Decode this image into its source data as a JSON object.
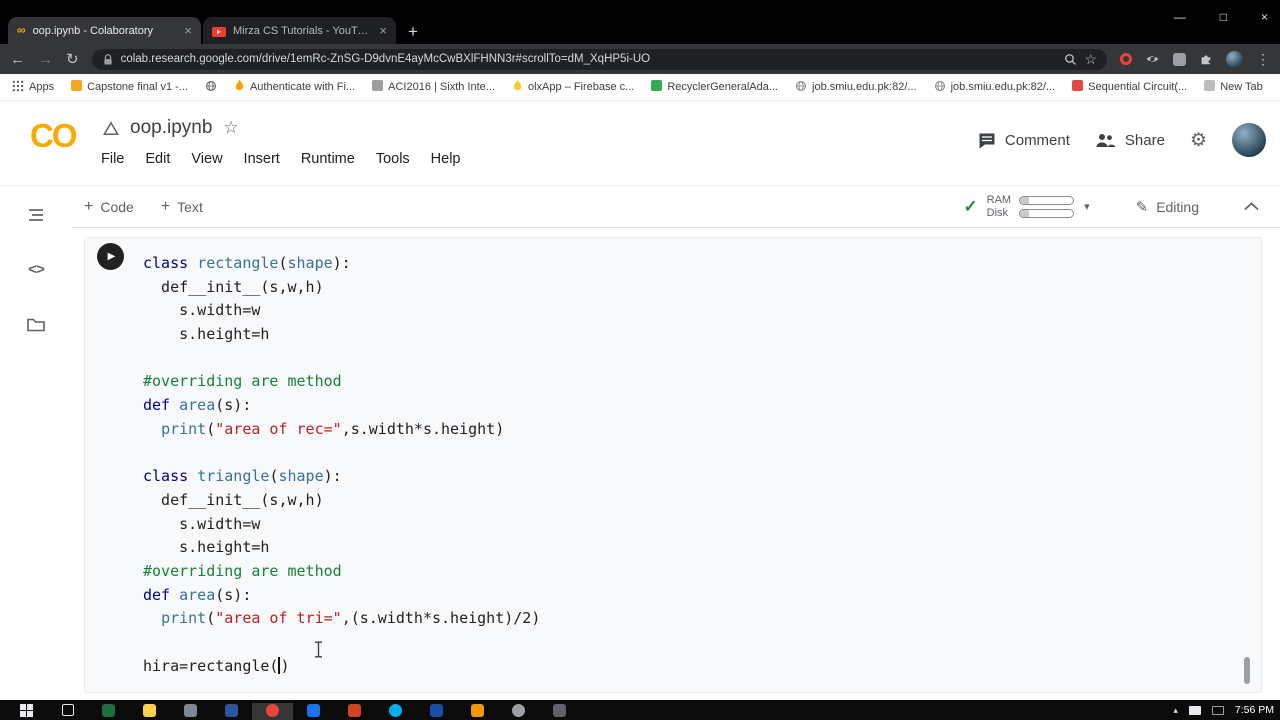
{
  "window": {
    "minimize": "—",
    "maximize": "□",
    "close": "×"
  },
  "browser": {
    "tabs": [
      {
        "label": "oop.ipynb - Colaboratory",
        "favicon": "colab",
        "active": true
      },
      {
        "label": "Mirza CS Tutorials - YouTube",
        "favicon": "youtube",
        "active": false
      }
    ],
    "new_tab_label": "+",
    "nav": {
      "back": "←",
      "forward": "→",
      "refresh": "↻"
    },
    "url": "colab.research.google.com/drive/1emRc-ZnSG-D9dvnE4ayMcCwBXlFHNN3r#scrollTo=dM_XqHP5i-UO",
    "extension_icons": [
      "zoom-icon",
      "bookmark-star-icon",
      "adblock-extension-icon",
      "eye-extension-icon",
      "extension-icon",
      "extensions-puzzle-icon",
      "profile-avatar",
      "browser-menu-icon"
    ],
    "bookmarks": [
      {
        "label": "Apps",
        "icon": "grid",
        "color": "#5f6368"
      },
      {
        "label": "Capstone final v1 -...",
        "icon": "square",
        "color": "#f5a623"
      },
      {
        "label": "",
        "icon": "globe",
        "color": "#5f6368"
      },
      {
        "label": "Authenticate with Fi...",
        "icon": "flame",
        "color": "#ffa000"
      },
      {
        "label": "ACI2016 | Sixth Inte...",
        "icon": "square",
        "color": "#9e9e9e"
      },
      {
        "label": "olxApp – Firebase c...",
        "icon": "flame",
        "color": "#ffca28"
      },
      {
        "label": "RecyclerGeneralAda...",
        "icon": "square",
        "color": "#34a853"
      },
      {
        "label": "job.smiu.edu.pk:82/...",
        "icon": "globe",
        "color": "#80868b"
      },
      {
        "label": "job.smiu.edu.pk:82/...",
        "icon": "globe",
        "color": "#80868b"
      },
      {
        "label": "Sequential Circuit(...",
        "icon": "square",
        "color": "#e04a3f"
      },
      {
        "label": "New Tab",
        "icon": "square",
        "color": "#bdbdbd"
      }
    ]
  },
  "colab": {
    "logo": "CO",
    "title": "oop.ipynb",
    "menus": [
      "File",
      "Edit",
      "View",
      "Insert",
      "Runtime",
      "Tools",
      "Help"
    ],
    "comment": "Comment",
    "share": "Share",
    "toolbar": {
      "add_code": "Code",
      "add_text": "Text",
      "ram": "RAM",
      "disk": "Disk",
      "editing": "Editing"
    }
  },
  "code": {
    "lines": [
      [
        [
          "class ",
          "kw"
        ],
        [
          "rectangle",
          "nm"
        ],
        [
          "(",
          "pl"
        ],
        [
          "shape",
          "nm"
        ],
        [
          "):",
          "pl"
        ]
      ],
      [
        [
          "  def__init__(s,w,h)",
          "pl"
        ]
      ],
      [
        [
          "    s.width=w",
          "pl"
        ]
      ],
      [
        [
          "    s.height=h",
          "pl"
        ]
      ],
      [],
      [
        [
          "#overriding are method",
          "cm"
        ]
      ],
      [
        [
          "def ",
          "kw"
        ],
        [
          "area",
          "nm"
        ],
        [
          "(s):",
          "pl"
        ]
      ],
      [
        [
          "  ",
          "pl"
        ],
        [
          "print",
          "nm"
        ],
        [
          "(",
          "pl"
        ],
        [
          "\"area of rec=\"",
          "st"
        ],
        [
          ",s.width*s.height)",
          "pl"
        ]
      ],
      [],
      [
        [
          "class ",
          "kw"
        ],
        [
          "triangle",
          "nm"
        ],
        [
          "(",
          "pl"
        ],
        [
          "shape",
          "nm"
        ],
        [
          "):",
          "pl"
        ]
      ],
      [
        [
          "  def__init__(s,w,h)",
          "pl"
        ]
      ],
      [
        [
          "    s.width=w",
          "pl"
        ]
      ],
      [
        [
          "    s.height=h",
          "pl"
        ]
      ],
      [
        [
          "#overriding are method",
          "cm"
        ]
      ],
      [
        [
          "def ",
          "kw"
        ],
        [
          "area",
          "nm"
        ],
        [
          "(s):",
          "pl"
        ]
      ],
      [
        [
          "  ",
          "pl"
        ],
        [
          "print",
          "nm"
        ],
        [
          "(",
          "pl"
        ],
        [
          "\"area of tri=\"",
          "st"
        ],
        [
          ",(s.width*s.height)/2)",
          "pl"
        ]
      ],
      [],
      [
        [
          "hira=rectangle(",
          "pl"
        ],
        [
          "",
          "caret"
        ],
        [
          ")",
          "pl"
        ]
      ]
    ]
  },
  "taskbar": {
    "clock": "7:56 PM",
    "icons": [
      {
        "name": "start-button",
        "shape": "win"
      },
      {
        "name": "task-view-button",
        "shape": "outline"
      },
      {
        "name": "taskbar-app-excel",
        "shape": "square",
        "color": "#1d6f42"
      },
      {
        "name": "taskbar-app-file-explorer",
        "shape": "square",
        "color": "#ffd04c"
      },
      {
        "name": "taskbar-app-3",
        "shape": "square",
        "color": "#7b8794"
      },
      {
        "name": "taskbar-app-word",
        "shape": "square",
        "color": "#2b579a"
      },
      {
        "name": "taskbar-app-browser",
        "shape": "circle",
        "color": "#e8453c",
        "active": true
      },
      {
        "name": "taskbar-app-5",
        "shape": "square",
        "color": "#1a73e8"
      },
      {
        "name": "taskbar-app-powerpoint",
        "shape": "square",
        "color": "#d04423"
      },
      {
        "name": "taskbar-app-skype",
        "shape": "circle",
        "color": "#00aff0"
      },
      {
        "name": "taskbar-app-7",
        "shape": "square",
        "color": "#174ea6"
      },
      {
        "name": "taskbar-app-8",
        "shape": "square",
        "color": "#f29900"
      },
      {
        "name": "taskbar-app-9",
        "shape": "circle",
        "color": "#9aa0a6"
      },
      {
        "name": "taskbar-app-10",
        "shape": "square",
        "color": "#5f6368"
      }
    ]
  }
}
